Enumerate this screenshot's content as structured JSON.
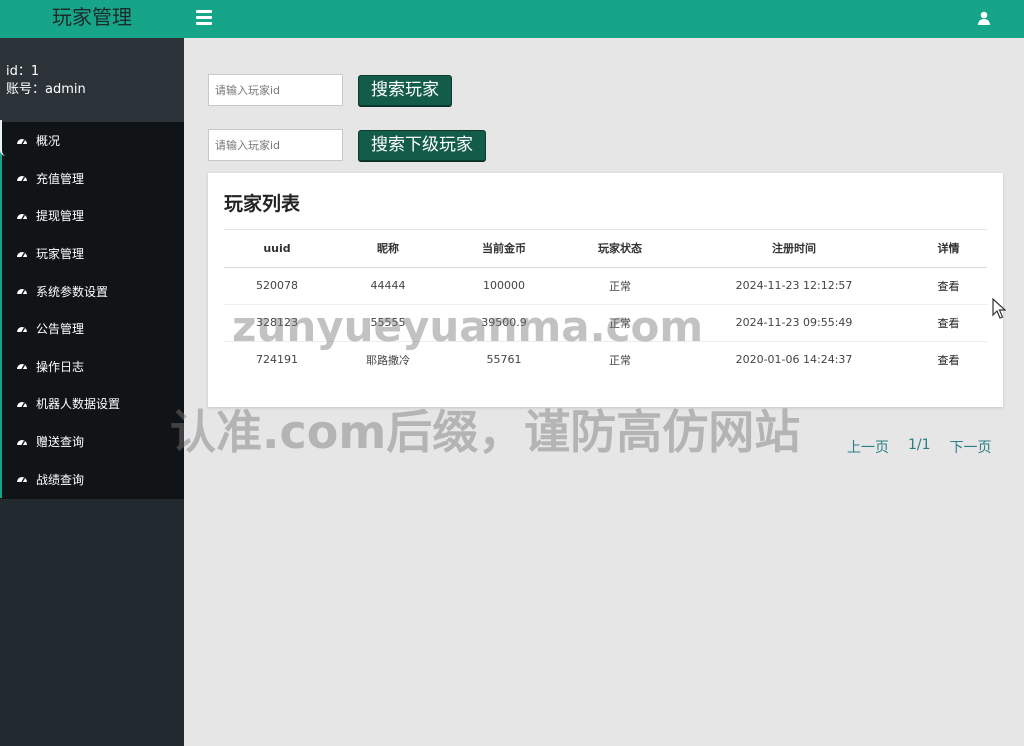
{
  "sidebar": {
    "brand": "玩家管理",
    "user_id": "id：1",
    "user_account": "账号：admin",
    "items": [
      {
        "label": "概况"
      },
      {
        "label": "充值管理"
      },
      {
        "label": "提现管理"
      },
      {
        "label": "玩家管理"
      },
      {
        "label": "系统参数设置"
      },
      {
        "label": "公告管理"
      },
      {
        "label": "操作日志"
      },
      {
        "label": "机器人数据设置"
      },
      {
        "label": "赠送查询"
      },
      {
        "label": "战绩查询"
      }
    ]
  },
  "topbar": {
    "menu_icon": "menu-icon",
    "user_icon": "user-icon"
  },
  "search": {
    "player": {
      "placeholder": "请输入玩家id",
      "value": "",
      "button": "搜索玩家"
    },
    "subordinate": {
      "placeholder": "请输入玩家id",
      "value": "",
      "button": "搜索下级玩家"
    }
  },
  "table": {
    "title": "玩家列表",
    "headers": [
      "uuid",
      "昵称",
      "当前金币",
      "玩家状态",
      "注册时间",
      "详情"
    ],
    "rows": [
      {
        "uuid": "520078",
        "nickname": "44444",
        "coins": "100000",
        "status": "正常",
        "reg_time": "2024-11-23 12:12:57",
        "detail": "查看"
      },
      {
        "uuid": "328123",
        "nickname": "55555",
        "coins": "39500.9",
        "status": "正常",
        "reg_time": "2024-11-23 09:55:49",
        "detail": "查看"
      },
      {
        "uuid": "724191",
        "nickname": "耶路撒冷",
        "coins": "55761",
        "status": "正常",
        "reg_time": "2020-01-06 14:24:37",
        "detail": "查看"
      }
    ]
  },
  "pager": {
    "prev": "上一页",
    "info": "1/1",
    "next": "下一页"
  },
  "watermark": {
    "line1": "zunyueyuanma.com",
    "line2": "认准.com后缀，谨防高仿网站"
  },
  "colors": {
    "accent": "#17a589",
    "sidebar_bg": "#222a30",
    "menu_bg": "#111417",
    "button_bg": "#145c4a",
    "link": "#2a7f86"
  }
}
